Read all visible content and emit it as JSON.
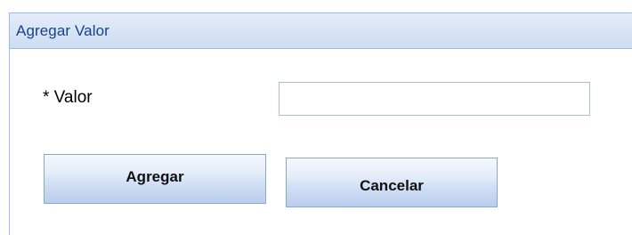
{
  "dialog": {
    "title": "Agregar Valor"
  },
  "form": {
    "value_label": "* Valor",
    "value_input": {
      "value": "",
      "placeholder": ""
    }
  },
  "buttons": {
    "add_label": "Agregar",
    "cancel_label": "Cancelar"
  },
  "colors": {
    "title_text": "#15428b",
    "border": "#99bbe8",
    "header_bg": "#dae6f6",
    "button_bg": "#d5e2f6"
  }
}
